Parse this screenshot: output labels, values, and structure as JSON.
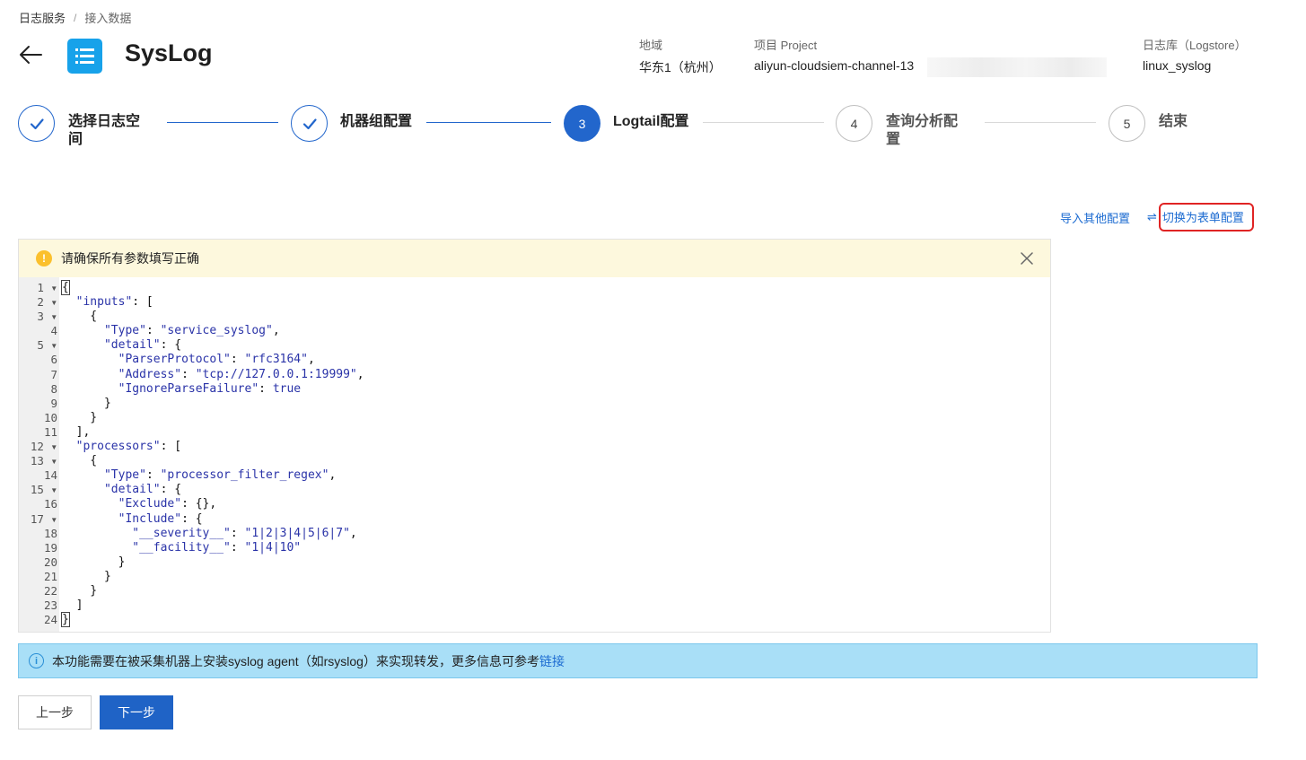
{
  "breadcrumb": [
    "日志服务",
    "接入数据"
  ],
  "breadcrumb_sep": "/",
  "header": {
    "title": "SysLog",
    "region_label": "地域",
    "region_value": "华东1（杭州）",
    "project_label": "项目 Project",
    "project_value": "aliyun-cloudsiem-channel-13",
    "logstore_label": "日志库（Logstore）",
    "logstore_value": "linux_syslog"
  },
  "steps": [
    {
      "num": "1",
      "label": "选择日志空间",
      "state": "done"
    },
    {
      "num": "2",
      "label": "机器组配置",
      "state": "done"
    },
    {
      "num": "3",
      "label": "Logtail配置",
      "state": "active"
    },
    {
      "num": "4",
      "label": "查询分析配置",
      "state": "todo"
    },
    {
      "num": "5",
      "label": "结束",
      "state": "todo"
    }
  ],
  "links": {
    "import": "导入其他配置",
    "switch": "切换为表单配置"
  },
  "warning": {
    "text": "请确保所有参数填写正确"
  },
  "code_lines": [
    "{",
    "  \"inputs\": [",
    "    {",
    "      \"Type\": \"service_syslog\",",
    "      \"detail\": {",
    "        \"ParserProtocol\": \"rfc3164\",",
    "        \"Address\": \"tcp://127.0.0.1:19999\",",
    "        \"IgnoreParseFailure\": true",
    "      }",
    "    }",
    "  ],",
    "  \"processors\": [",
    "    {",
    "      \"Type\": \"processor_filter_regex\",",
    "      \"detail\": {",
    "        \"Exclude\": {},",
    "        \"Include\": {",
    "          \"__severity__\": \"1|2|3|4|5|6|7\",",
    "          \"__facility__\": \"1|4|10\"",
    "        }",
    "      }",
    "    }",
    "  ]",
    "}"
  ],
  "fold_lines": [
    1,
    2,
    3,
    5,
    12,
    13,
    15,
    17
  ],
  "info": {
    "text": "本功能需要在被采集机器上安装syslog agent（如rsyslog）来实现转发，更多信息可参考",
    "link": "链接"
  },
  "buttons": {
    "prev": "上一步",
    "next": "下一步"
  }
}
